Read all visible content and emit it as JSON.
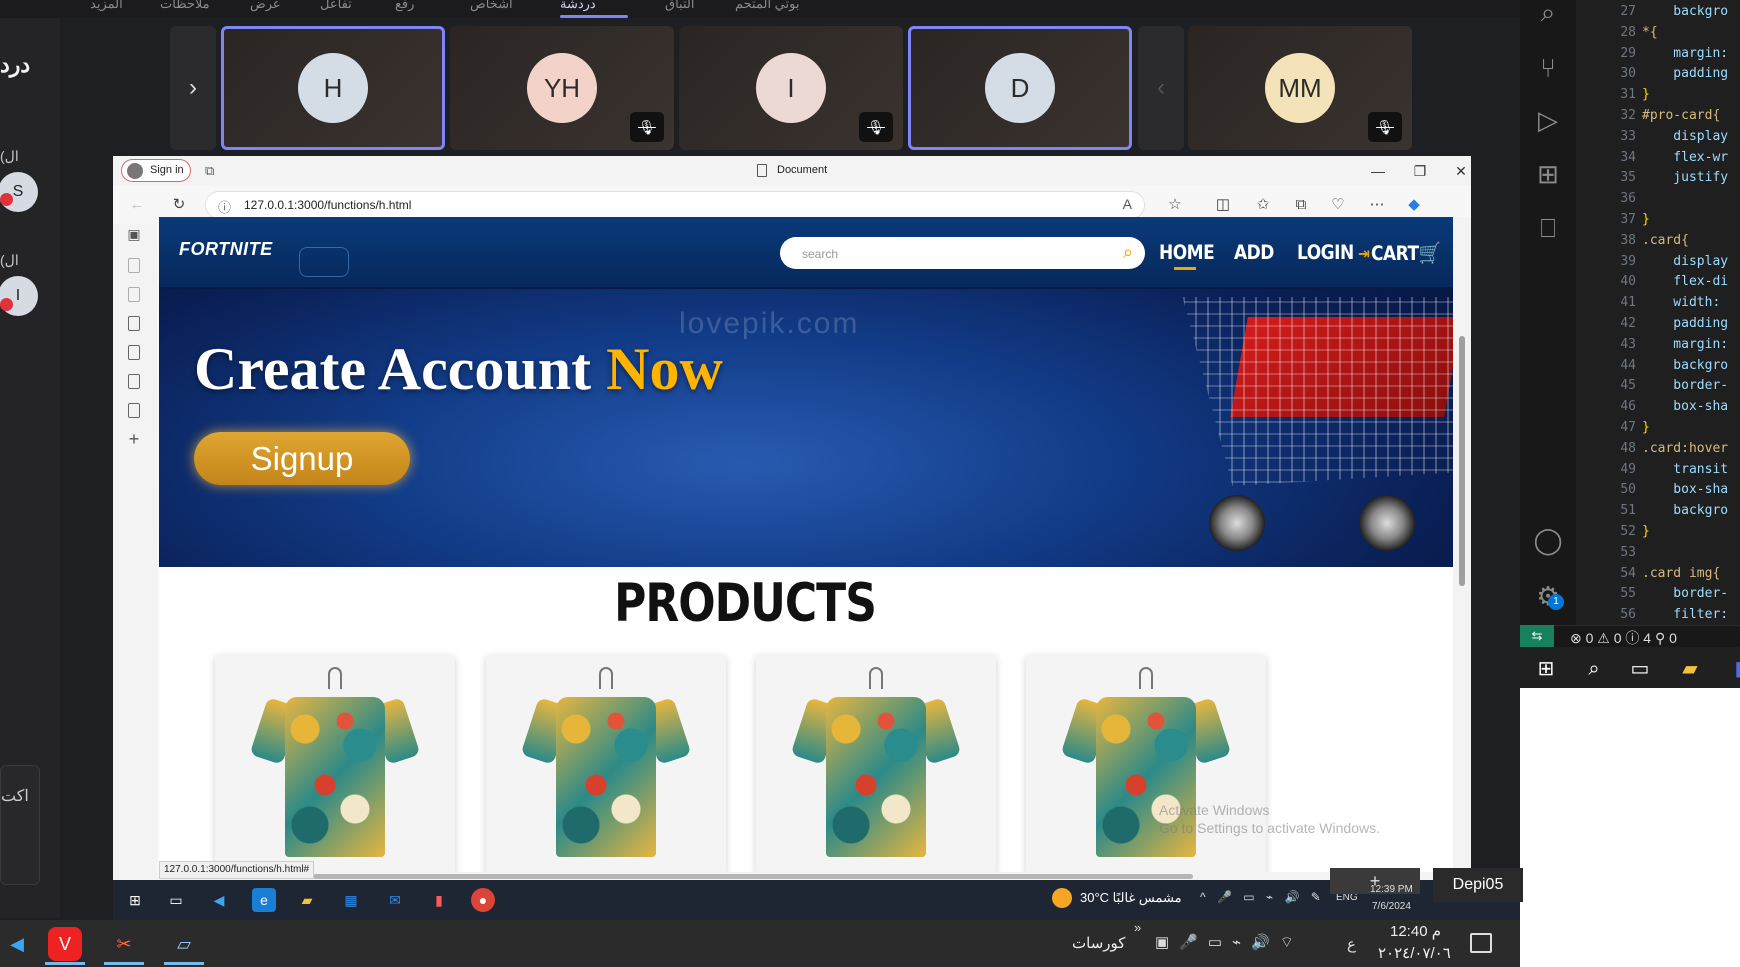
{
  "meeting": {
    "tabs": [
      "المزيد",
      "ملاحظات",
      "عرض",
      "تفاعل",
      "رفع",
      "أشخاص",
      "دردشة",
      "التباق",
      "بوتي المتحم"
    ],
    "active_tab_index": 6,
    "left_title": "درد",
    "left_sub_1": "(ال",
    "left_sub_2": "(ال",
    "left_avatar_1": "S",
    "left_avatar_2": "I",
    "left_box_label": "اكت",
    "next_arrow": "›",
    "prev_arrow": "‹",
    "tiles": [
      {
        "initials": "H",
        "bg": "#d4dde6",
        "active": true,
        "muted": false
      },
      {
        "initials": "YH",
        "bg": "#f2d2c9",
        "active": false,
        "muted": true
      },
      {
        "initials": "I",
        "bg": "#ecd9d6",
        "active": false,
        "muted": true
      },
      {
        "initials": "D",
        "bg": "#d4dde6",
        "active": true,
        "muted": false
      },
      {
        "initials": "MM",
        "bg": "#f4e2b8",
        "active": false,
        "muted": true
      }
    ]
  },
  "vscode": {
    "line_numbers": [
      "27",
      "28",
      "29",
      "30",
      "31",
      "32",
      "33",
      "34",
      "35",
      "36",
      "37",
      "38",
      "39",
      "40",
      "41",
      "42",
      "43",
      "44",
      "45",
      "46",
      "47",
      "48",
      "49",
      "50",
      "51",
      "52",
      "53",
      "54",
      "55",
      "56"
    ],
    "lines": [
      "    backgro",
      "*{",
      "    margin:",
      "    padding",
      "}",
      "#pro-card{",
      "    display",
      "    flex-wr",
      "    justify",
      "",
      "}",
      ".card{",
      "    display",
      "    flex-di",
      "    width:",
      "    padding",
      "    margin:",
      "    backgro",
      "    border-",
      "    box-sha",
      "}",
      ".card:hover",
      "    transit",
      "    box-sha",
      "    backgro",
      "}",
      "",
      ".card img{",
      "    border-",
      "    filter:"
    ],
    "status": "⊗ 0 ⚠ 0 ⓘ 4   ⚲ 0",
    "badge": "1"
  },
  "browser": {
    "signin_label": "Sign in",
    "tab_title": "Document",
    "url": "127.0.0.1:3000/functions/h.html",
    "status_url": "127.0.0.1:3000/functions/h.html#"
  },
  "site": {
    "logo": "FORTNITE",
    "search_placeholder": "search",
    "nav": {
      "home": "HOME",
      "add": "ADD",
      "login": "LOGIN",
      "cart": "CART"
    },
    "hero_title_main": "Create Account ",
    "hero_title_accent": "Now",
    "signup_label": "Signup",
    "hero_watermark": "lovepik.com",
    "products_title": "PRODUCTS",
    "product_count": 4,
    "windows_watermark_1": "Activate Windows",
    "windows_watermark_2": "Go to Settings to activate Windows."
  },
  "inner_taskbar": {
    "weather": "30°C  مشمس غالبًا",
    "lang": "ENG",
    "time": "12:39 PM",
    "date": "7/6/2024",
    "depi": "Depi05",
    "plus": "+"
  },
  "outer_taskbar": {
    "courses": "كورسات",
    "time": "12:40 م",
    "date": "٢٠٢٤/٠٧/٠٦",
    "lang": "ع"
  }
}
